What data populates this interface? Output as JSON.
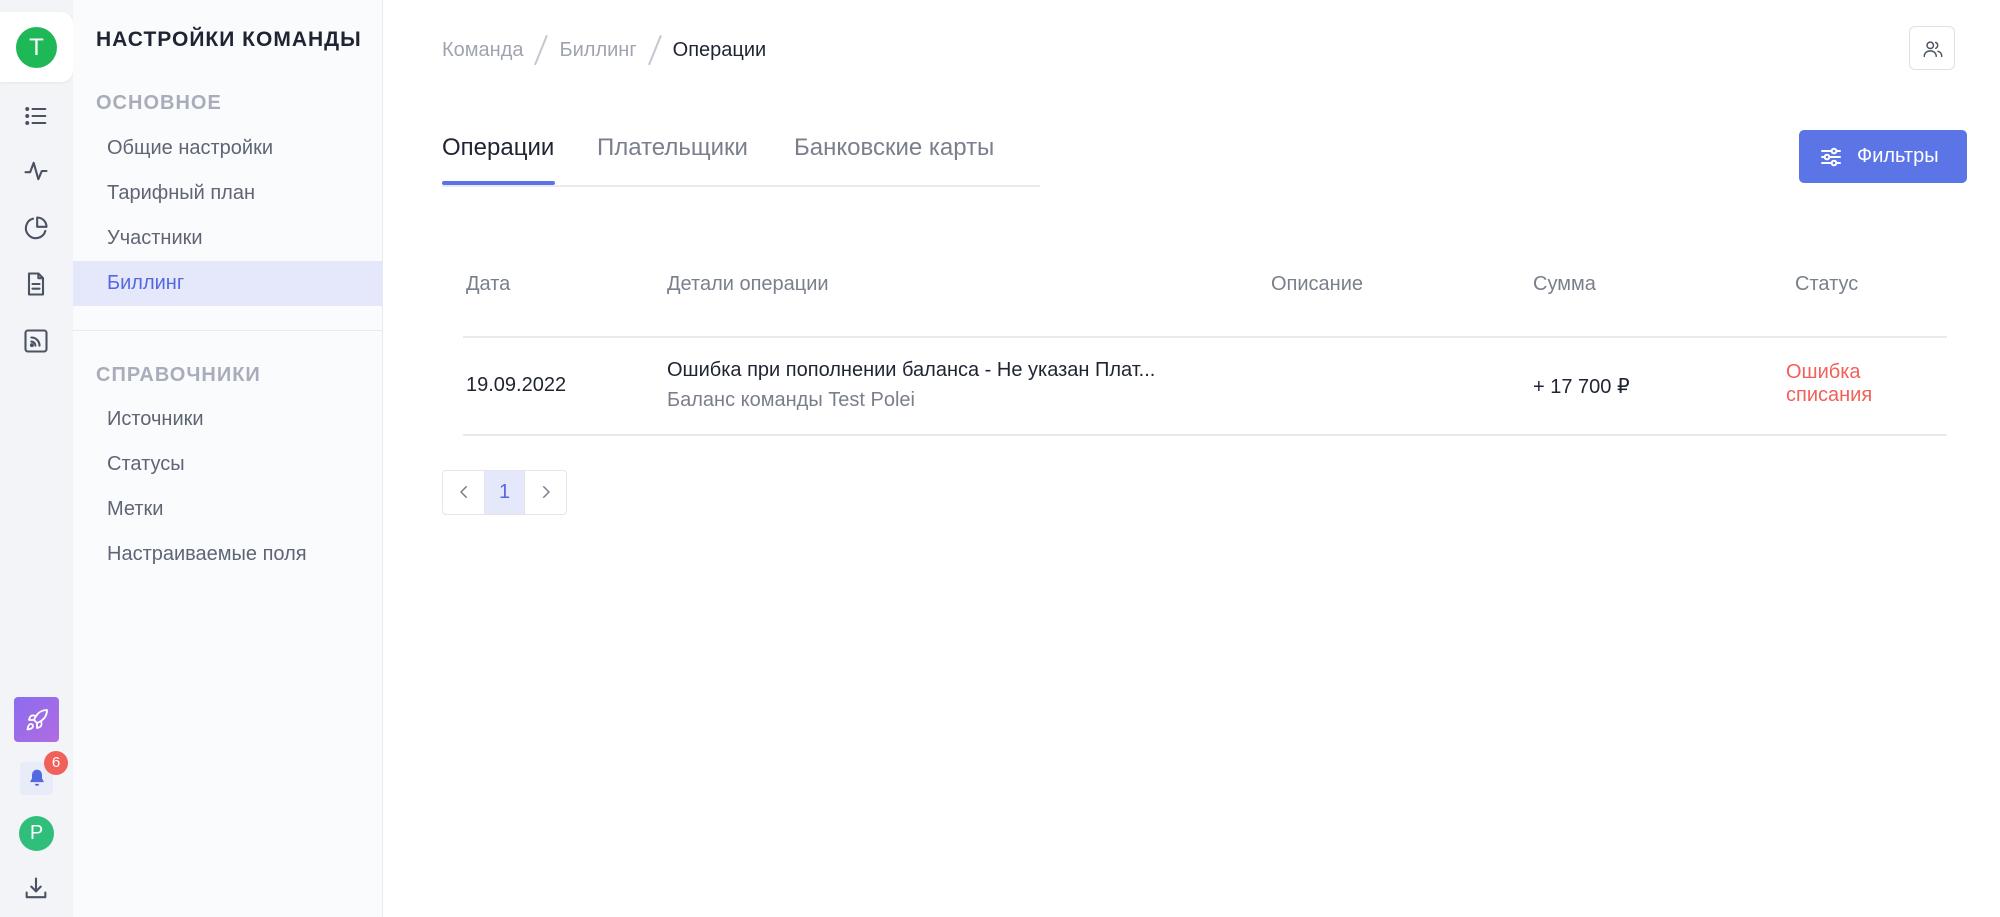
{
  "rail": {
    "team_initial": "Т",
    "notification_count": "6",
    "user_initial": "Р",
    "icons": [
      "list-icon",
      "activity-icon",
      "pie-chart-icon",
      "document-icon",
      "rss-icon",
      "rocket-icon",
      "bell-icon",
      "download-icon"
    ]
  },
  "sidebar": {
    "title": "НАСТРОЙКИ КОМАНДЫ",
    "section_main": "ОСНОВНОЕ",
    "items_main": [
      "Общие настройки",
      "Тарифный план",
      "Участники",
      "Биллинг"
    ],
    "active_item": "Биллинг",
    "section_refs": "СПРАВОЧНИКИ",
    "items_refs": [
      "Источники",
      "Статусы",
      "Метки",
      "Настраиваемые поля"
    ]
  },
  "breadcrumb": [
    "Команда",
    "Биллинг",
    "Операции"
  ],
  "tabs": [
    "Операции",
    "Плательщики",
    "Банковские карты"
  ],
  "active_tab": "Операции",
  "filters_label": "Фильтры",
  "table": {
    "headers": [
      "Дата",
      "Детали операции",
      "Описание",
      "Сумма",
      "Статус"
    ],
    "rows": [
      {
        "date": "19.09.2022",
        "details_title": "Ошибка при пополнении баланса - Не указан Плат...",
        "details_sub": "Баланс команды Test Polei",
        "description": "",
        "amount": "+ 17 700 ₽",
        "status": "Ошибка списания"
      }
    ]
  },
  "pagination": {
    "current": "1"
  },
  "colors": {
    "accent": "#5c75e6",
    "error": "#f2605a",
    "team_avatar": "#1fb856",
    "user_avatar": "#2fbf7a",
    "active_bg": "#e5e8fa"
  }
}
